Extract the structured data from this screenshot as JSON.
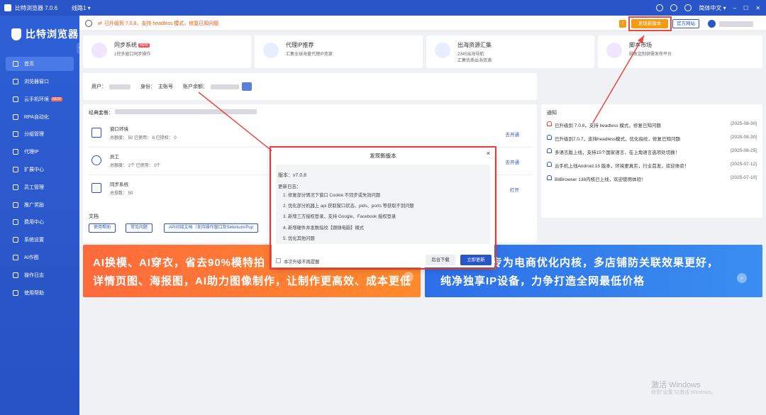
{
  "titlebar": {
    "app_name": "比特浏览器 7.0.6",
    "line": "线路1 ▾",
    "language": "简体中文 ▾",
    "minimize": "–",
    "maximize": "☐",
    "close": "✕"
  },
  "sidebar": {
    "brand": "比特浏览器",
    "items": [
      {
        "label": "首页"
      },
      {
        "label": "浏览器窗口"
      },
      {
        "label": "云手机环境",
        "badge": "NEW"
      },
      {
        "label": "RPA自动化"
      },
      {
        "label": "分组管理"
      },
      {
        "label": "代理IP"
      },
      {
        "label": "扩展中心"
      },
      {
        "label": "员工管理"
      },
      {
        "label": "推广奖励"
      },
      {
        "label": "费用中心"
      },
      {
        "label": "系统设置"
      },
      {
        "label": "AI作图"
      },
      {
        "label": "操作日志"
      },
      {
        "label": "使用帮助"
      }
    ]
  },
  "topbar": {
    "notice": "已升级到 7.0.8，支持 headless 模式，修复已知问题",
    "update_btn": "发现新版本",
    "site_btn": "官方网站",
    "warn": "!"
  },
  "features": [
    {
      "title": "同步系统",
      "tag": "NEW",
      "sub": "1控多窗口同步操作",
      "sub2": ""
    },
    {
      "title": "代理IP推荐",
      "tag": "",
      "sub": "汇集全球海量代理IP资源",
      "sub2": ""
    },
    {
      "title": "出海资源汇集",
      "tag": "",
      "sub": "2345出海导航",
      "sub2": "汇集优质出海资源"
    },
    {
      "title": "脚本市场",
      "tag": "",
      "sub": "脚本定制供需发布平台",
      "sub2": ""
    }
  ],
  "userbar": {
    "user_label": "用户：",
    "role_label": "身份：",
    "role_value": "主账号",
    "balance_label": "账户余额："
  },
  "package": {
    "title": "经典套餐：",
    "rows": [
      {
        "title": "窗口环境",
        "stats": "总额度：  50   已使用：  8   已授权：  0",
        "link": "去开通"
      },
      {
        "title": "员工",
        "stats": "总额度：  2个   已使用：  0个",
        "link": "去开通"
      },
      {
        "title": "同步系统",
        "stats": "总授数：  50",
        "link": "打开"
      }
    ]
  },
  "docs": {
    "title": "文档",
    "buttons": [
      "使用帮助",
      "常见问题",
      "API对接文档（支持操作窗口及Selenium/Pup"
    ]
  },
  "notices": {
    "title": "通知",
    "items": [
      {
        "text": "已升级到 7.0.8，支持 headless 模式，修复已知问题",
        "date": "[2025-08-30]"
      },
      {
        "text": "已升级到7.0.7，支持headless模式，优化指纹，修复已知问题",
        "date": "[2025-08-30]"
      },
      {
        "text": "多语言版上线，支持15个国家语言，在上角语言选项处切换！",
        "date": "[2025-08-25]"
      },
      {
        "text": "云手机上线Android 15 版本，环境更真实，行业首发，欢迎体验！",
        "date": "[2025-07-12]"
      },
      {
        "text": "BitBrowser 138内核已上线，欢迎使用体验！",
        "date": "[2025-07-10]"
      }
    ]
  },
  "banners": {
    "left_line1": "AI换模、AI穿衣，省去90%模特拍",
    "left_line2": "详情页图、海报图，AI助力图像制作，让制作更高效、成本更低",
    "right_line1": "专为电商优化内核，多店铺防关联效果更好，",
    "right_line2": "纯净独享IP设备，力争打造全网最低价格"
  },
  "watermark": {
    "line1": "激活 Windows",
    "line2": "转到\"设置\"以激活 Windows。"
  },
  "modal": {
    "title": "发现新版本",
    "close": "×",
    "version": "版本：v7.0.8",
    "log_title": "更新日志：",
    "lines": [
      "1. 修复部分情况下窗口 Cookie 不同步或失效问题",
      "2. 优化部分机器上 api 获取窗口状态、pids、ports 等获取不到问题",
      "3. 新增三方授权登录，支持 Google、Facebook 授权登录",
      "4. 新增硬件并发数指纹【跟随电脑】模式",
      "5. 优化其他问题"
    ],
    "no_remind": "本次升级不再提醒",
    "bg_download": "后台下载",
    "update_now": "立即更新"
  }
}
